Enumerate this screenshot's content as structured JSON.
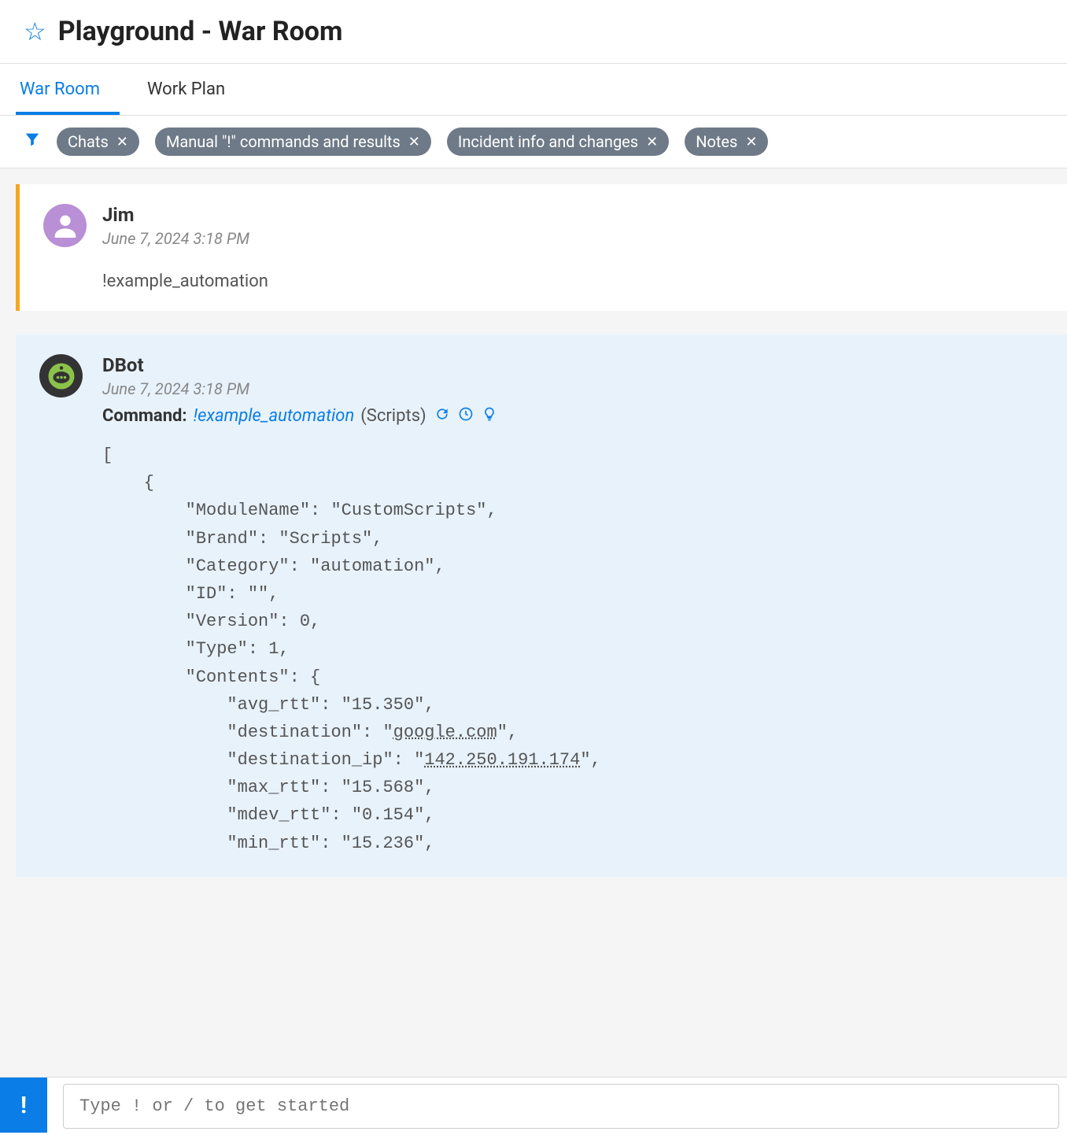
{
  "header": {
    "title": "Playground - War Room"
  },
  "tabs": [
    {
      "label": "War Room",
      "active": true
    },
    {
      "label": "Work Plan",
      "active": false
    }
  ],
  "filter_chips": [
    "Chats",
    "Manual \"!\" commands and results",
    "Incident info and changes",
    "Notes"
  ],
  "messages": [
    {
      "type": "user",
      "author": "Jim",
      "timestamp": "June 7, 2024 3:18 PM",
      "body": "!example_automation"
    },
    {
      "type": "bot",
      "author": "DBot",
      "timestamp": "June 7, 2024 3:18 PM",
      "command_label": "Command:",
      "command_text": "!example_automation",
      "command_context": "(Scripts)",
      "output": {
        "ModuleName": "CustomScripts",
        "Brand": "Scripts",
        "Category": "automation",
        "ID": "",
        "Version": 0,
        "Type": 1,
        "Contents": {
          "avg_rtt": "15.350",
          "destination": "google.com",
          "destination_ip": "142.250.191.174",
          "max_rtt": "15.568",
          "mdev_rtt": "0.154",
          "min_rtt": "15.236"
        }
      }
    }
  ],
  "input": {
    "placeholder": "Type ! or / to get started",
    "button_label": "!"
  }
}
